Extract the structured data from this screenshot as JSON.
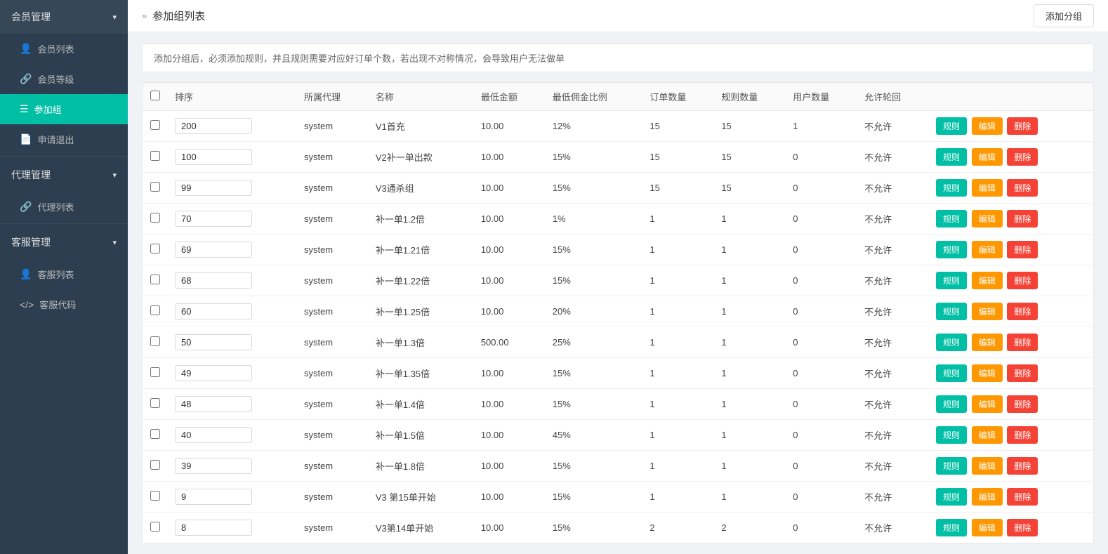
{
  "sidebar": {
    "groups": [
      {
        "label": "会员管理",
        "expanded": true,
        "items": [
          {
            "id": "member-list",
            "label": "会员列表",
            "icon": "👤",
            "active": false
          },
          {
            "id": "member-level",
            "label": "会员等级",
            "icon": "🔗",
            "active": false
          },
          {
            "id": "group",
            "label": "参加组",
            "icon": "☰",
            "active": true
          },
          {
            "id": "apply-exit",
            "label": "申请退出",
            "icon": "📄",
            "active": false
          }
        ]
      },
      {
        "label": "代理管理",
        "expanded": true,
        "items": [
          {
            "id": "agent-list",
            "label": "代理列表",
            "icon": "🔗",
            "active": false
          }
        ]
      },
      {
        "label": "客服管理",
        "expanded": true,
        "items": [
          {
            "id": "cs-list",
            "label": "客服列表",
            "icon": "👤",
            "active": false
          },
          {
            "id": "cs-code",
            "label": "客服代码",
            "icon": "</>",
            "active": false
          }
        ]
      }
    ]
  },
  "page": {
    "title": "参加组列表",
    "breadcrumb_arrow": "»",
    "add_button_label": "添加分组",
    "notice": "添加分组后，必须添加规则，并且规则需要对应好订单个数，若出现不对称情况，会导致用户无法做单"
  },
  "table": {
    "columns": [
      "排序",
      "所属代理",
      "名称",
      "最低金额",
      "最低佣金比例",
      "订单数量",
      "规则数量",
      "用户数量",
      "允许轮回"
    ],
    "btn_rule": "规则",
    "btn_edit": "编辑",
    "btn_delete": "删除",
    "rows": [
      {
        "order": "200",
        "agent": "system",
        "name": "V1首充",
        "min_amount": "10.00",
        "min_rate": "12%",
        "order_count": "15",
        "rule_count": "15",
        "user_count": "1",
        "allow_cycle": "不允许"
      },
      {
        "order": "100",
        "agent": "system",
        "name": "V2补一单出款",
        "min_amount": "10.00",
        "min_rate": "15%",
        "order_count": "15",
        "rule_count": "15",
        "user_count": "0",
        "allow_cycle": "不允许"
      },
      {
        "order": "99",
        "agent": "system",
        "name": "V3通杀组",
        "min_amount": "10.00",
        "min_rate": "15%",
        "order_count": "15",
        "rule_count": "15",
        "user_count": "0",
        "allow_cycle": "不允许"
      },
      {
        "order": "70",
        "agent": "system",
        "name": "补一单1.2倍",
        "min_amount": "10.00",
        "min_rate": "1%",
        "order_count": "1",
        "rule_count": "1",
        "user_count": "0",
        "allow_cycle": "不允许"
      },
      {
        "order": "69",
        "agent": "system",
        "name": "补一单1.21倍",
        "min_amount": "10.00",
        "min_rate": "15%",
        "order_count": "1",
        "rule_count": "1",
        "user_count": "0",
        "allow_cycle": "不允许"
      },
      {
        "order": "68",
        "agent": "system",
        "name": "补一单1.22倍",
        "min_amount": "10.00",
        "min_rate": "15%",
        "order_count": "1",
        "rule_count": "1",
        "user_count": "0",
        "allow_cycle": "不允许"
      },
      {
        "order": "60",
        "agent": "system",
        "name": "补一单1.25倍",
        "min_amount": "10.00",
        "min_rate": "20%",
        "order_count": "1",
        "rule_count": "1",
        "user_count": "0",
        "allow_cycle": "不允许"
      },
      {
        "order": "50",
        "agent": "system",
        "name": "补一单1.3倍",
        "min_amount": "500.00",
        "min_rate": "25%",
        "order_count": "1",
        "rule_count": "1",
        "user_count": "0",
        "allow_cycle": "不允许"
      },
      {
        "order": "49",
        "agent": "system",
        "name": "补一单1.35倍",
        "min_amount": "10.00",
        "min_rate": "15%",
        "order_count": "1",
        "rule_count": "1",
        "user_count": "0",
        "allow_cycle": "不允许"
      },
      {
        "order": "48",
        "agent": "system",
        "name": "补一单1.4倍",
        "min_amount": "10.00",
        "min_rate": "15%",
        "order_count": "1",
        "rule_count": "1",
        "user_count": "0",
        "allow_cycle": "不允许"
      },
      {
        "order": "40",
        "agent": "system",
        "name": "补一单1.5倍",
        "min_amount": "10.00",
        "min_rate": "45%",
        "order_count": "1",
        "rule_count": "1",
        "user_count": "0",
        "allow_cycle": "不允许"
      },
      {
        "order": "39",
        "agent": "system",
        "name": "补一单1.8倍",
        "min_amount": "10.00",
        "min_rate": "15%",
        "order_count": "1",
        "rule_count": "1",
        "user_count": "0",
        "allow_cycle": "不允许"
      },
      {
        "order": "9",
        "agent": "system",
        "name": "V3 第15单开始",
        "min_amount": "10.00",
        "min_rate": "15%",
        "order_count": "1",
        "rule_count": "1",
        "user_count": "0",
        "allow_cycle": "不允许"
      },
      {
        "order": "8",
        "agent": "system",
        "name": "V3第14单开始",
        "min_amount": "10.00",
        "min_rate": "15%",
        "order_count": "2",
        "rule_count": "2",
        "user_count": "0",
        "allow_cycle": "不允许"
      }
    ]
  }
}
